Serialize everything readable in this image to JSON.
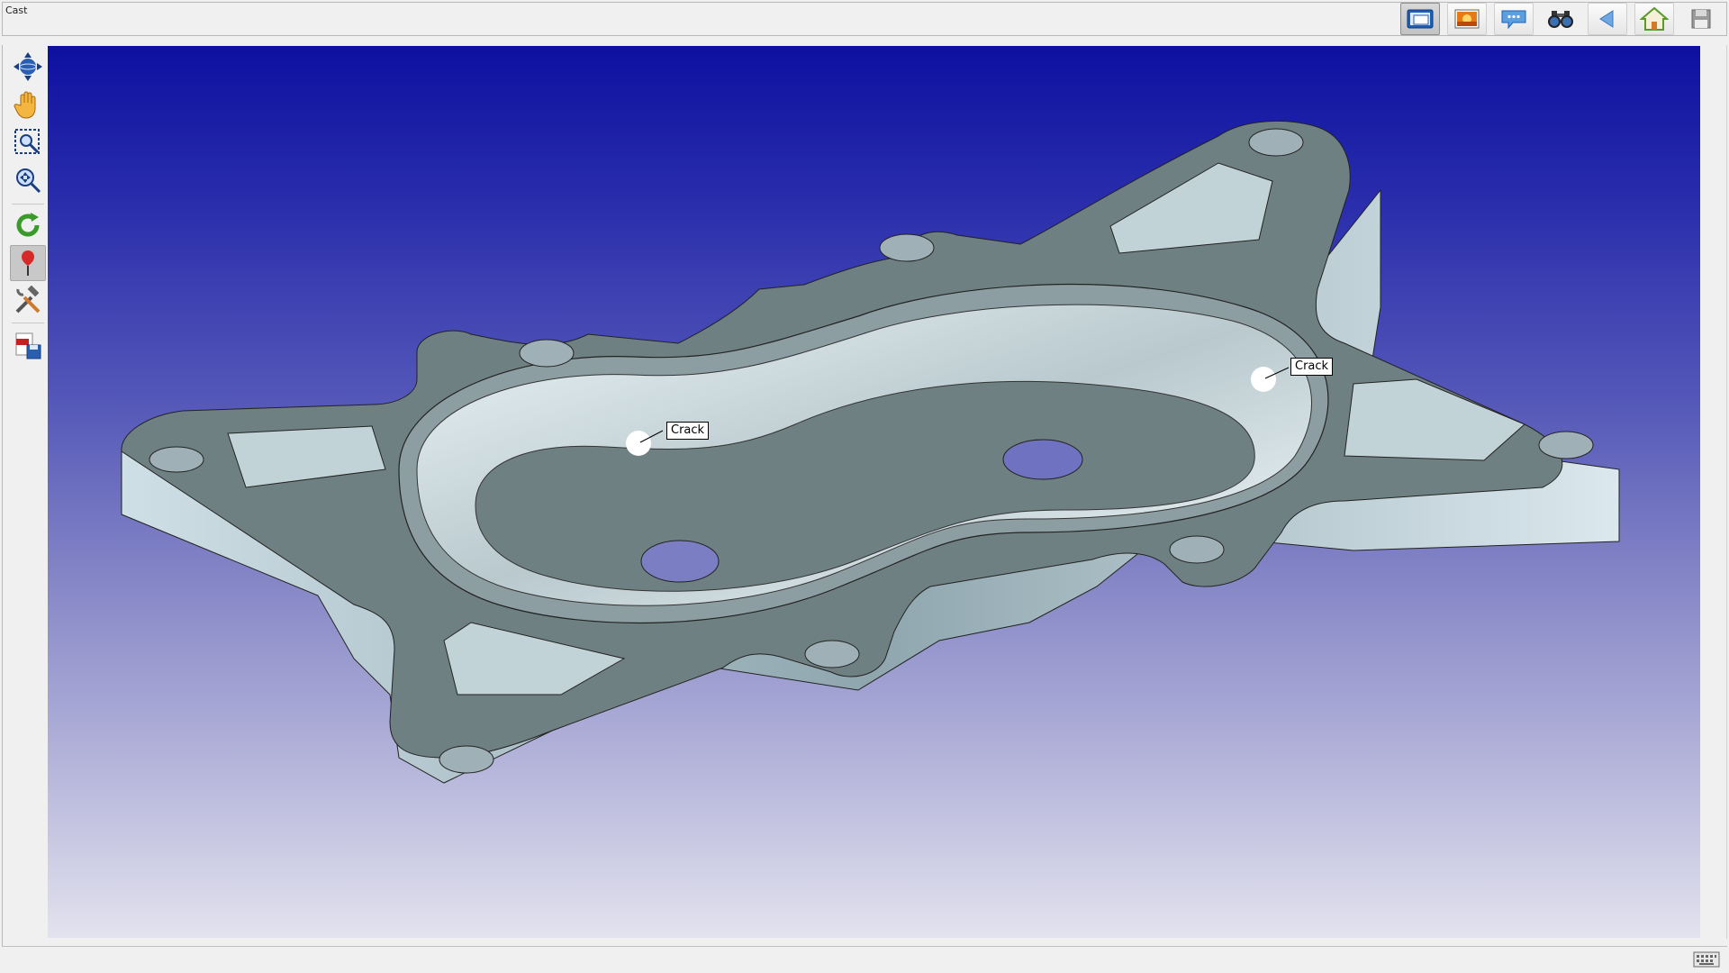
{
  "window": {
    "title": "Cast"
  },
  "top_toolbar": [
    {
      "name": "view-window-icon",
      "tooltip": "",
      "active": true
    },
    {
      "name": "image-icon",
      "active": false
    },
    {
      "name": "annotation-comment-icon",
      "active": false
    },
    {
      "name": "binoculars-icon",
      "active": false
    },
    {
      "name": "back-arrow-icon",
      "active": false
    },
    {
      "name": "home-icon",
      "active": false
    },
    {
      "name": "save-disk-icon",
      "active": false
    }
  ],
  "left_toolbar": [
    {
      "name": "rotate-view-icon",
      "active": false
    },
    {
      "name": "pan-hand-icon",
      "active": false
    },
    {
      "name": "zoom-window-icon",
      "active": false
    },
    {
      "name": "zoom-fit-icon",
      "active": false
    },
    {
      "name": "refresh-icon",
      "active": false
    },
    {
      "name": "pin-marker-icon",
      "active": true
    },
    {
      "name": "tools-icon",
      "active": false
    },
    {
      "name": "pdf-export-icon",
      "active": false
    }
  ],
  "viewport": {
    "background_top": "#0d10a0",
    "background_bottom": "#e3e2ee",
    "model_color": "#6f8083",
    "annotations": [
      {
        "label": "Crack"
      },
      {
        "label": "Crack"
      }
    ]
  },
  "status_bar": {
    "keyboard_icon": "keyboard-icon"
  }
}
